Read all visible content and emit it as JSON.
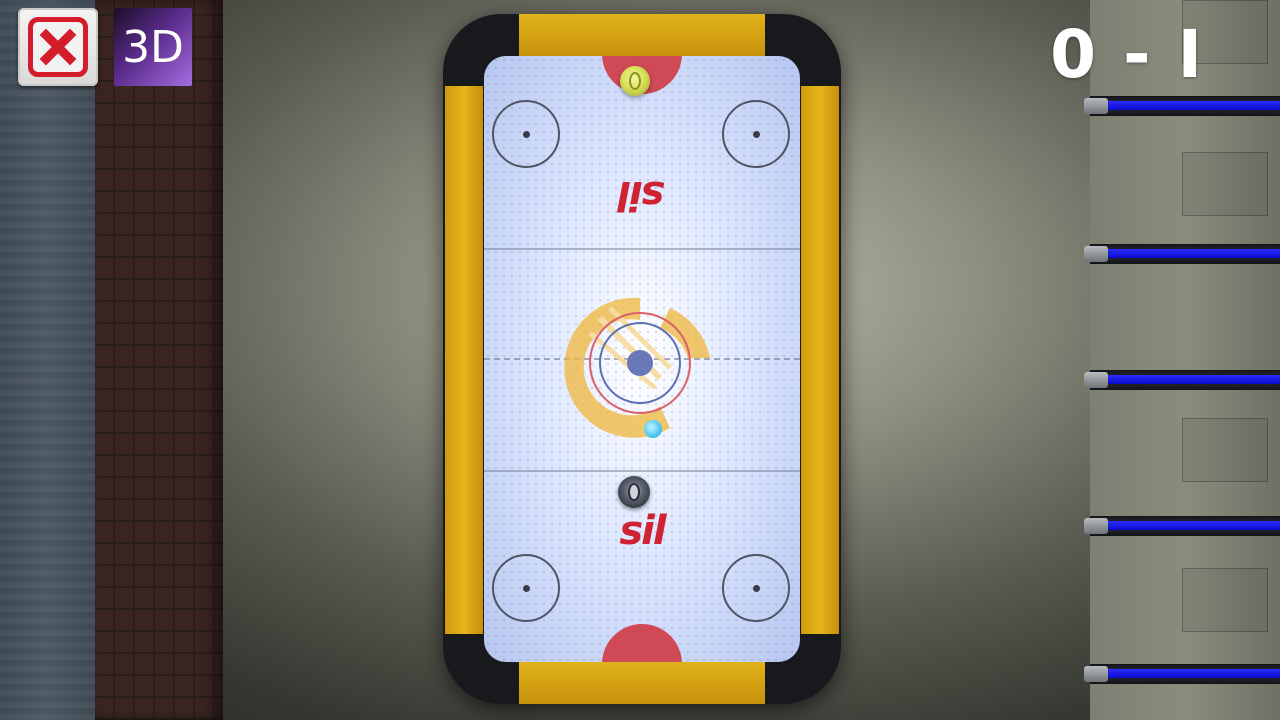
{
  "score": {
    "text": "0 - I",
    "player": 0,
    "opponent": 1
  },
  "controls": {
    "close_icon": "close-icon",
    "view_label": "3D"
  },
  "table": {
    "logo_text": "sil",
    "accent_color": "#cf2333",
    "rail_color": "#e0b21a",
    "puck_color": "#4cc7ee",
    "player_paddle": "dark-paddle",
    "opponent_paddle": "yellow-paddle"
  }
}
